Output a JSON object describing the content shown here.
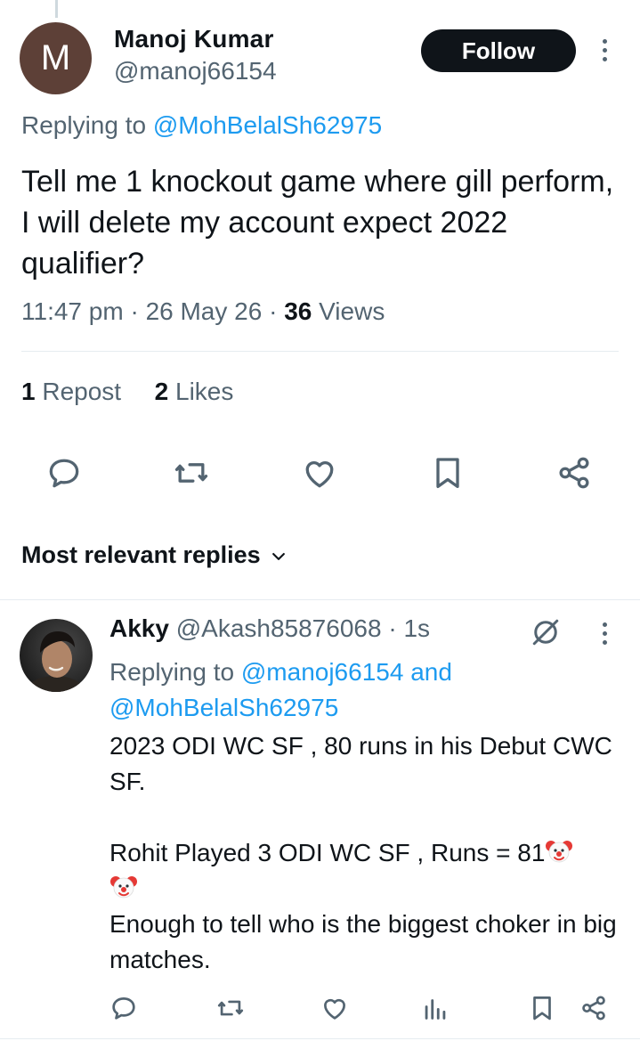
{
  "tweet": {
    "avatar_letter": "M",
    "author_name": "Manoj Kumar",
    "author_handle": "@manoj66154",
    "follow_label": "Follow",
    "replying_prefix": "Replying to",
    "replying_to": "@MohBelalSh62975",
    "text": "Tell me 1 knockout game where gill perform, I will delete my account expect 2022 qualifier?",
    "time": "11:47 pm",
    "date": "26 May 26",
    "views_count": "36",
    "views_label": "Views",
    "repost_count": "1",
    "repost_label": "Repost",
    "likes_count": "2",
    "likes_label": "Likes"
  },
  "replies_section": {
    "sort_label": "Most relevant replies"
  },
  "reply": {
    "name": "Akky",
    "handle": "@Akash85876068",
    "time": "1s",
    "replying_prefix": "Replying to",
    "replying_user1": "@manoj66154",
    "replying_and": "and",
    "replying_user2": "@MohBelalSh62975",
    "line1": "2023 ODI WC SF , 80 runs in his Debut CWC SF.",
    "line2": "Rohit Played 3 ODI WC SF , Runs = 81",
    "line3": "Enough to tell who is the biggest choker in big matches."
  },
  "colors": {
    "accent_link": "#1d9bf0",
    "secondary_text": "#536471",
    "primary_text": "#0f1419",
    "follow_bg": "#0f1419",
    "avatar_bg": "#5d4037"
  },
  "icons": {
    "tweet_actions": [
      "reply-icon",
      "retweet-icon",
      "like-icon",
      "bookmark-icon",
      "share-icon"
    ],
    "reply_actions": [
      "reply-icon",
      "retweet-icon",
      "like-icon",
      "views-icon",
      "bookmark-icon",
      "share-icon"
    ],
    "emoji": "clown-face"
  }
}
